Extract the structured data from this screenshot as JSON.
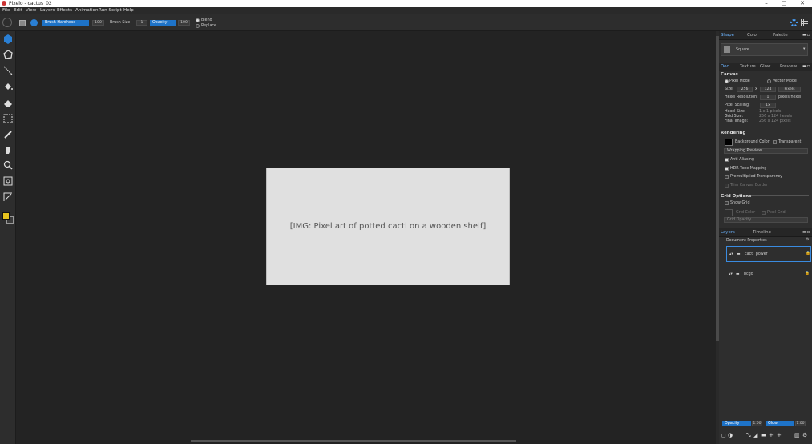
{
  "window": {
    "title": "Pixelo - cactus_02",
    "minimize": "–",
    "maximize": "□",
    "close": "✕"
  },
  "menu": [
    "File",
    "Edit",
    "View",
    "Layers",
    "Effects",
    "Animation",
    "Run Script",
    "Help"
  ],
  "options": {
    "brush_hardness_label": "Brush Hardness",
    "brush_hardness_value": "100",
    "brush_size_label": "Brush Size",
    "brush_size_value": "1",
    "opacity_label": "Opacity",
    "opacity_value": "100",
    "blend_label": "Blend",
    "replace_label": "Replace"
  },
  "tools": [
    "select-hex",
    "lasso",
    "line",
    "fill",
    "eraser",
    "marquee",
    "eyedropper",
    "hand",
    "zoom",
    "crop",
    "transform"
  ],
  "colors": {
    "primary": "#e6c31e",
    "secondary": "#3a3a3a",
    "accent": "#1e73c8",
    "wood": "#a85f14",
    "wood_dark": "#7b430d"
  },
  "shape_panel": {
    "tabs": [
      "Shape",
      "Color",
      "Palette"
    ],
    "active_tab": "Shape",
    "shape_value": "Square"
  },
  "settings_panel": {
    "tabs": [
      "Doc",
      "Texture",
      "Glow",
      "Preview"
    ],
    "canvas_section": "Canvas",
    "pixel_mode": "Pixel Mode",
    "vector_mode": "Vector Mode",
    "size_label": "Size:",
    "size_w": "256",
    "size_x": "x",
    "size_h": "124",
    "size_unit": "Pixels",
    "hexel_res_label": "Hexel Resolution:",
    "hexel_res_value": "1",
    "hexel_res_unit": "pixels/hexel",
    "pixel_scaling_label": "Pixel Scaling:",
    "pixel_scaling_value": "1x",
    "hexel_size_label": "Hexel Size:",
    "hexel_size_value": "1 x 1 pixels",
    "grid_size_label": "Grid Size:",
    "grid_size_value": "256 x 124 hexels",
    "final_image_label": "Final Image:",
    "final_image_value": "256 x 124 pixels",
    "rendering_section": "Rendering",
    "bg_color_label": "Background Color",
    "transparent_label": "Transparent",
    "wrapping_label": "Wrapping Preview",
    "anti_aliasing": "Anti-Aliasing",
    "hdr": "HDR Tone Mapping",
    "premult": "Premultiplied Transparency",
    "trim": "Trim Canvas Border",
    "grid_section": "Grid Options",
    "show_grid": "Show Grid",
    "grid_color": "Grid Color",
    "pixel_grid": "Pixel Grid",
    "grid_opacity": "Grid Opacity"
  },
  "layers_panel": {
    "tabs": [
      "Layers",
      "Timeline"
    ],
    "doc_props": "Document Properties",
    "layers": [
      {
        "name": "cacti_power",
        "selected": true
      },
      {
        "name": "bcgd",
        "selected": false
      }
    ],
    "opacity_label": "Opacity",
    "opacity_value": "1.00",
    "glow_label": "Glow",
    "glow_value": "1.00"
  }
}
